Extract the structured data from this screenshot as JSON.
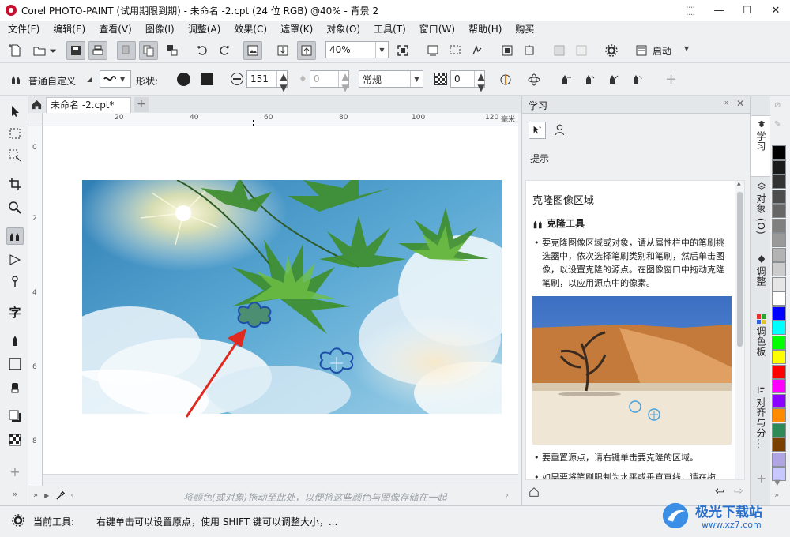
{
  "window": {
    "title": "Corel PHOTO-PAINT (试用期限到期) - 未命名 -2.cpt (24 位 RGB) @40% - 背景 2",
    "controls": [
      "⬚",
      "—",
      "☐",
      "✕"
    ]
  },
  "menu": [
    "文件(F)",
    "编辑(E)",
    "查看(V)",
    "图像(I)",
    "调整(A)",
    "效果(C)",
    "遮罩(K)",
    "对象(O)",
    "工具(T)",
    "窗口(W)",
    "帮助(H)",
    "购买"
  ],
  "toolbar": {
    "zoom_value": "40%",
    "launch_label": "启动"
  },
  "property_bar": {
    "brush_category": "普通自定义",
    "shape_label": "形状:",
    "size_value": "151",
    "opacity_value": "0",
    "merge_mode": "常规",
    "transparency_value": "0"
  },
  "document": {
    "tab_label": "未命名 -2.cpt*",
    "ruler_h_labels": [
      "20",
      "40",
      "60",
      "80",
      "100",
      "120"
    ],
    "ruler_v_labels": [
      "0",
      "2",
      "4",
      "6",
      "8"
    ],
    "ruler_unit": "毫米"
  },
  "palette_hint": "将颜色(或对象)拖动至此处，以便将这些颜色与图像存储在一起",
  "learn_panel": {
    "header": "学习",
    "hint_label": "提示",
    "topic_title": "克隆图像区域",
    "tool_title": "克隆工具",
    "para1": "要克隆图像区域或对象，请从属性栏中的笔刷挑选器中，依次选择笔刷类别和笔刷，然后单击图像，以设置克隆的源点。在图像窗口中拖动克隆笔刷，以应用源点中的像素。",
    "para2": "要重置源点，请右键单击要克隆的区域。",
    "para3": "如果要将笔刷限制为水平或垂直直线，请在拖"
  },
  "dock_tabs": [
    "学习",
    "对象 (O)",
    "调整",
    "调色板",
    "对齐与分..."
  ],
  "swatches": [
    "#000000",
    "#1a1a1a",
    "#333333",
    "#4d4d4d",
    "#666666",
    "#808080",
    "#999999",
    "#b3b3b3",
    "#cccccc",
    "#e6e6e6",
    "#ffffff",
    "#0000ff",
    "#00ffff",
    "#00ff00",
    "#ffff00",
    "#ff0000",
    "#ff00ff",
    "#8b00ff",
    "#ff8c00",
    "#2e8b57",
    "#7b3f00",
    "#b0a4e3",
    "#c8c8ff"
  ],
  "status": {
    "tool_label": "当前工具:",
    "tool_hint": "右键单击可以设置原点，使用 SHIFT 键可以调整大小，..."
  },
  "watermark_text": "极光下载站",
  "watermark_url": "www.xz7.com"
}
